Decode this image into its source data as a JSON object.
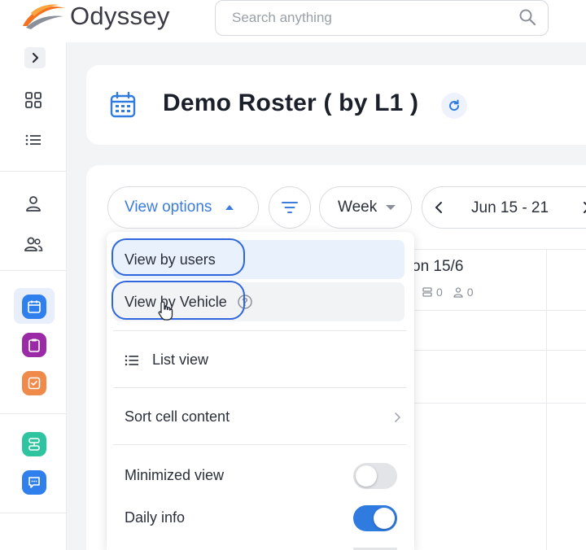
{
  "app": {
    "name": "Odyssey"
  },
  "search": {
    "placeholder": "Search anything"
  },
  "page": {
    "title": "Demo Roster ( by L1 )"
  },
  "toolbar": {
    "view_options_label": "View options",
    "week_label": "Week",
    "date_range": "Jun 15 - 21"
  },
  "schedule": {
    "column_header": "on 15/6",
    "vehicle_count": "0",
    "user_count": "0"
  },
  "view_menu": {
    "view_by_users": "View by users",
    "view_by_vehicle": "View by Vehicle",
    "list_view": "List view",
    "sort_cell_content": "Sort cell content",
    "minimized_view": {
      "label": "Minimized view",
      "on": false
    },
    "daily_info": {
      "label": "Daily info",
      "on": true
    }
  },
  "colors": {
    "accent": "#3b7cdd",
    "toggle_on": "#2f7be0",
    "toggle_off": "#e2e4e8",
    "tile_blue": "#2f80ed",
    "tile_purple": "#9b2aa6",
    "tile_orange": "#f08a4b",
    "tile_green": "#2ec4a0",
    "tile_blue2": "#2f80ed"
  },
  "icons": {
    "sidebar": [
      "chevron-right-icon",
      "grid-icon",
      "list-icon",
      "user-icon",
      "users-icon",
      "calendar-app-icon",
      "clipboard-app-icon",
      "task-app-icon",
      "route-app-icon",
      "chat-app-icon"
    ]
  }
}
